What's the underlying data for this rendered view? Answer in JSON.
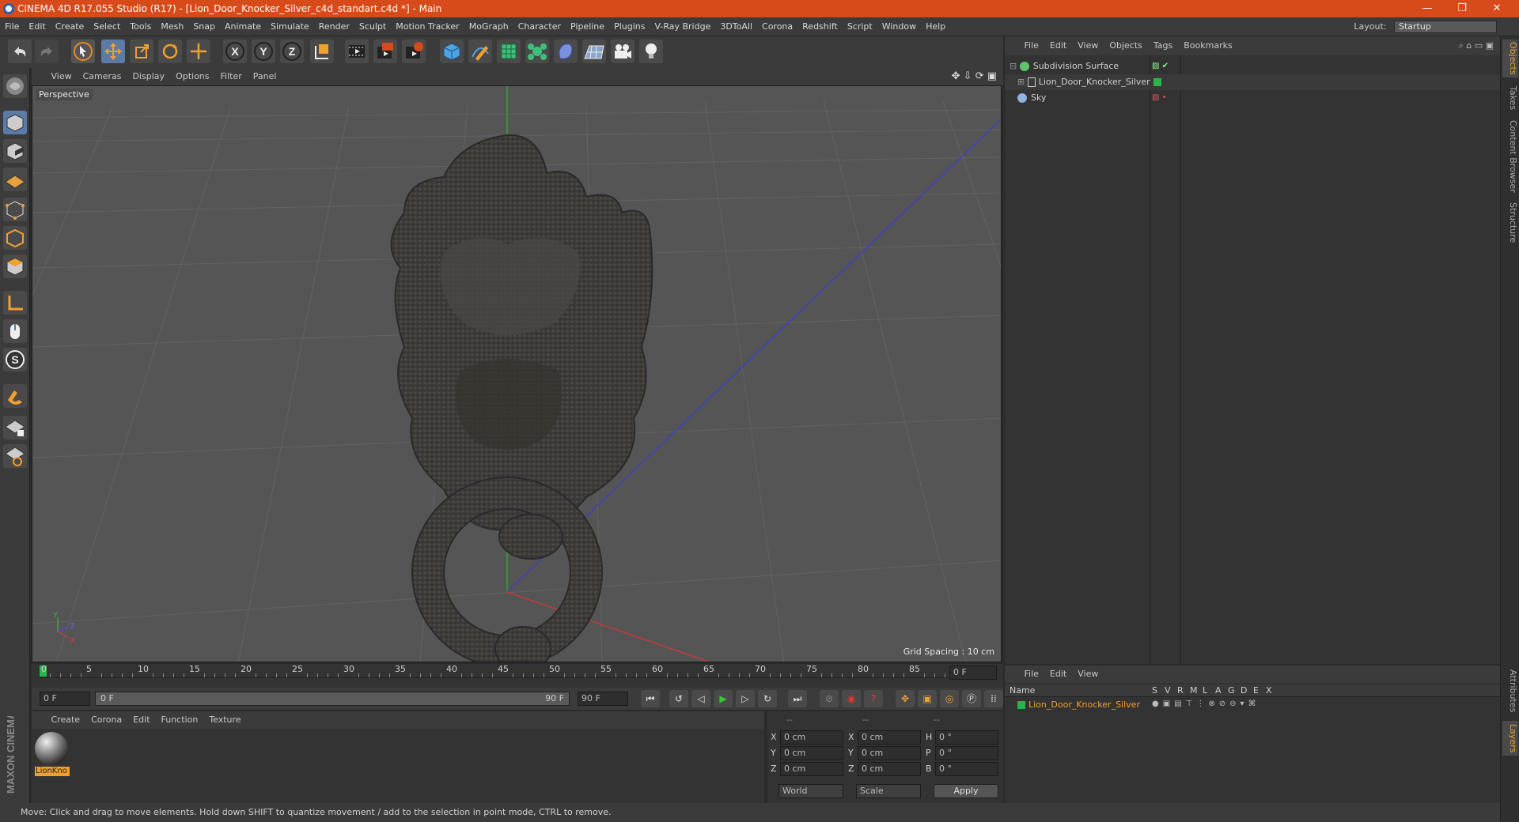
{
  "app": {
    "title": "CINEMA 4D R17.055 Studio (R17) - [Lion_Door_Knocker_Silver_c4d_standart.c4d *] - Main",
    "window_controls": {
      "minimize": "—",
      "maximize": "❐",
      "close": "✕"
    }
  },
  "menubar": {
    "items": [
      "File",
      "Edit",
      "Create",
      "Select",
      "Tools",
      "Mesh",
      "Snap",
      "Animate",
      "Simulate",
      "Render",
      "Sculpt",
      "Motion Tracker",
      "MoGraph",
      "Character",
      "Pipeline",
      "Plugins",
      "V-Ray Bridge",
      "3DToAll",
      "Corona",
      "Redshift",
      "Script",
      "Window",
      "Help"
    ],
    "layout_label": "Layout:",
    "layout_value": "Startup"
  },
  "toolbar": {
    "icons": [
      "undo-icon",
      "redo-icon",
      "live-select-icon",
      "move-icon",
      "scale-icon",
      "rotate-icon",
      "transform-icon",
      "x-axis-icon",
      "y-axis-icon",
      "z-axis-icon",
      "coordinate-system-icon",
      "render-view-icon",
      "render-picture-viewer-icon",
      "edit-render-settings-icon",
      "cube-primitive-icon",
      "pen-spline-icon",
      "subdivision-icon",
      "mograph-cloner-icon",
      "deformer-icon",
      "floor-icon",
      "camera-icon",
      "light-icon"
    ],
    "axis_labels": [
      "X",
      "Y",
      "Z"
    ]
  },
  "left_tools": [
    "make-editable-icon",
    "model-mode-icon",
    "texture-mode-icon",
    "workplane-icon",
    "points-mode-icon",
    "edges-mode-icon",
    "polygons-mode-icon",
    "axis-mode-icon",
    "tweak-mode-icon",
    "solo-icon",
    "snap-icon",
    "workplane-lock-icon",
    "locked-workplane-icon"
  ],
  "viewport": {
    "menu": [
      "View",
      "Cameras",
      "Display",
      "Options",
      "Filter",
      "Panel"
    ],
    "label": "Perspective",
    "grid_spacing": "Grid Spacing : 10 cm",
    "axis_labels": {
      "y": "Y",
      "z": "Z",
      "x": "X"
    }
  },
  "object_manager": {
    "menu": [
      "File",
      "Edit",
      "View",
      "Objects",
      "Tags",
      "Bookmarks"
    ],
    "objects": [
      {
        "name": "Subdivision Surface",
        "color": "#5fc46a"
      },
      {
        "name": "Lion_Door_Knocker_Silver",
        "color": "#cccccc"
      },
      {
        "name": "Sky",
        "color": "#8fb4e0"
      }
    ]
  },
  "side_tabs": {
    "top": [
      "Objects",
      "Takes",
      "Content Browser",
      "Structure"
    ],
    "bottom": [
      "Attributes",
      "Layers"
    ]
  },
  "timeline": {
    "ticks": [
      "0",
      "5",
      "10",
      "15",
      "20",
      "25",
      "30",
      "35",
      "40",
      "45",
      "50",
      "55",
      "60",
      "65",
      "70",
      "75",
      "80",
      "85",
      "90"
    ],
    "current_frame": "0 F"
  },
  "transport": {
    "start": "0 F",
    "range_start": "0 F",
    "range_end": "90 F",
    "end": "90 F"
  },
  "material_manager": {
    "menu": [
      "Create",
      "Corona",
      "Edit",
      "Function",
      "Texture"
    ],
    "material_name": "LionKno"
  },
  "coordinates": {
    "headers": [
      "--",
      "--",
      "--"
    ],
    "rows": [
      {
        "a": "X",
        "av": "0 cm",
        "b": "X",
        "bv": "0 cm",
        "c": "H",
        "cv": "0 °"
      },
      {
        "a": "Y",
        "av": "0 cm",
        "b": "Y",
        "bv": "0 cm",
        "c": "P",
        "cv": "0 °"
      },
      {
        "a": "Z",
        "av": "0 cm",
        "b": "Z",
        "bv": "0 cm",
        "c": "B",
        "cv": "0 °"
      }
    ],
    "mode1": "World",
    "mode2": "Scale",
    "apply": "Apply"
  },
  "layer_manager": {
    "menu": [
      "File",
      "Edit",
      "View"
    ],
    "columns": [
      "Name",
      "S",
      "V",
      "R",
      "M",
      "L",
      "A",
      "G",
      "D",
      "E",
      "X"
    ],
    "layer_name": "Lion_Door_Knocker_Silver"
  },
  "brand": "MAXON CINEMA 4D",
  "status": "Move: Click and drag to move elements. Hold down SHIFT to quantize movement / add to the selection in point mode, CTRL to remove."
}
